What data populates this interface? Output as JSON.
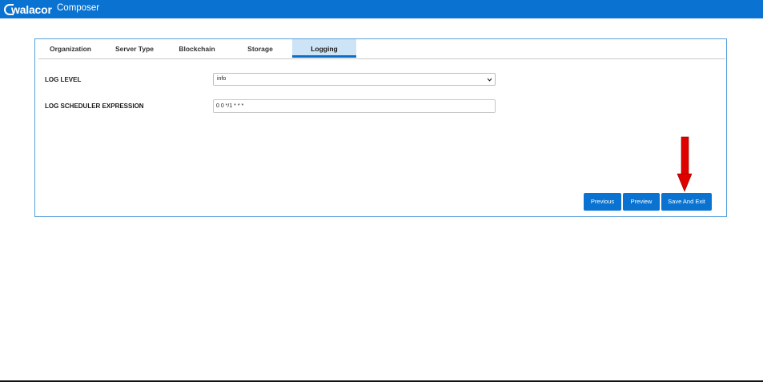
{
  "app": {
    "logo_text": "walacor",
    "title": "Composer"
  },
  "tabs": [
    {
      "label": "Organization",
      "active": false
    },
    {
      "label": "Server Type",
      "active": false
    },
    {
      "label": "Blockchain",
      "active": false
    },
    {
      "label": "Storage",
      "active": false
    },
    {
      "label": "Logging",
      "active": true
    }
  ],
  "form": {
    "log_level": {
      "label": "LOG LEVEL",
      "value": "info"
    },
    "log_scheduler": {
      "label": "LOG SCHEDULER EXPRESSION",
      "value": "0 0 */1 * * *"
    }
  },
  "buttons": {
    "previous": "Previous",
    "preview": "Preview",
    "save_exit": "Save And Exit"
  },
  "annotation": {
    "arrow_color": "#e00000"
  },
  "colors": {
    "brand_blue": "#0a73d1",
    "active_tab_bg": "#cde3f6"
  },
  "icons": {
    "select_chevron": "chevron-down-icon",
    "annotation_arrow": "down-arrow-icon"
  }
}
